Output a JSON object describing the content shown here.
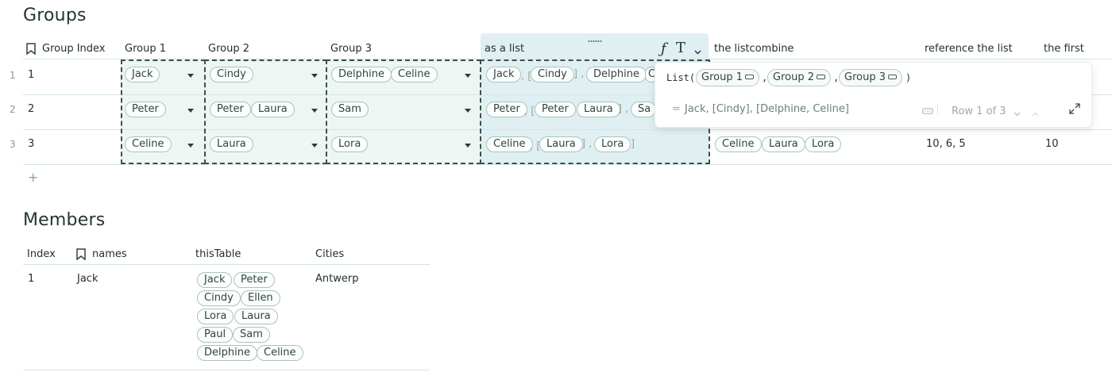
{
  "groups": {
    "title": "Groups",
    "headers": {
      "group_index": "Group Index",
      "group1": "Group 1",
      "group2": "Group 2",
      "group3": "Group 3",
      "as_list": "as a list",
      "listcombine": "the listcombine",
      "reference": "reference the list",
      "first": "the first"
    },
    "header_icons": {
      "bookmark": "bookmark-icon",
      "formula": "ƒ",
      "text_type": "T",
      "chevron": "chevron-down-icon",
      "drag": "drag-handle-icon"
    },
    "rows": [
      {
        "num": "1",
        "index": "1",
        "group1": [
          "Jack"
        ],
        "group2": [
          "Cindy"
        ],
        "group3": [
          "Delphine",
          "Celine"
        ],
        "as_list": [
          "Jack",
          "Cindy",
          "Delphine",
          "C"
        ],
        "listcombine": [],
        "reference": "",
        "first": ""
      },
      {
        "num": "2",
        "index": "2",
        "group1": [
          "Peter"
        ],
        "group2": [
          "Peter",
          "Laura"
        ],
        "group3": [
          "Sam"
        ],
        "as_list": [
          "Peter",
          "Peter",
          "Laura",
          "Sa"
        ],
        "listcombine": [],
        "reference": "",
        "first": ""
      },
      {
        "num": "3",
        "index": "3",
        "group1": [
          "Celine"
        ],
        "group2": [
          "Laura"
        ],
        "group3": [
          "Lora"
        ],
        "as_list": [
          "Celine",
          "Laura",
          "Lora"
        ],
        "listcombine": [
          "Celine",
          "Laura",
          "Lora"
        ],
        "reference": "10, 6, 5",
        "first": "10"
      }
    ],
    "add_row": "+"
  },
  "formula_popup": {
    "fn_open": "List(",
    "fn_close": ")",
    "comma": ",",
    "args": [
      "Group 1",
      "Group 2",
      "Group 3"
    ],
    "result_eq": "=",
    "result": "Jack, [Cindy], [Delphine, Celine]",
    "row_label": "Row 1 of 3",
    "icons": {
      "ref": "reference-icon",
      "prev": "chevron-down-icon",
      "next": "chevron-up-icon",
      "expand": "expand-icon"
    }
  },
  "members": {
    "title": "Members",
    "headers": {
      "index": "Index",
      "names": "names",
      "thistable": "thisTable",
      "cities": "Cities"
    },
    "rows": [
      {
        "index": "1",
        "name": "Jack",
        "thistable": [
          [
            "Jack",
            "Peter"
          ],
          [
            "Cindy",
            "Ellen"
          ],
          [
            "Lora",
            "Laura"
          ],
          [
            "Paul",
            "Sam"
          ],
          [
            "Delphine",
            "Celine"
          ]
        ],
        "city": "Antwerp"
      }
    ]
  },
  "colors": {
    "selection": "#eef6f4",
    "active_column": "#dfeff2",
    "chip_border": "#a9c3bd",
    "grid_line": "#d4e6e1"
  }
}
